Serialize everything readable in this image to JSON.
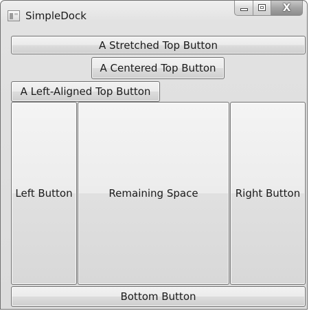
{
  "window": {
    "title": "SimpleDock"
  },
  "caption_buttons": {
    "minimize_icon": "minimize-icon",
    "maximize_icon": "maximize-icon",
    "close_glyph": "X"
  },
  "dock": {
    "stretched_top": "A Stretched Top Button",
    "centered_top": "A Centered Top Button",
    "left_aligned_top": "A Left-Aligned Top Button",
    "left": "Left Button",
    "remaining": "Remaining Space",
    "right": "Right Button",
    "bottom": "Bottom Button"
  }
}
